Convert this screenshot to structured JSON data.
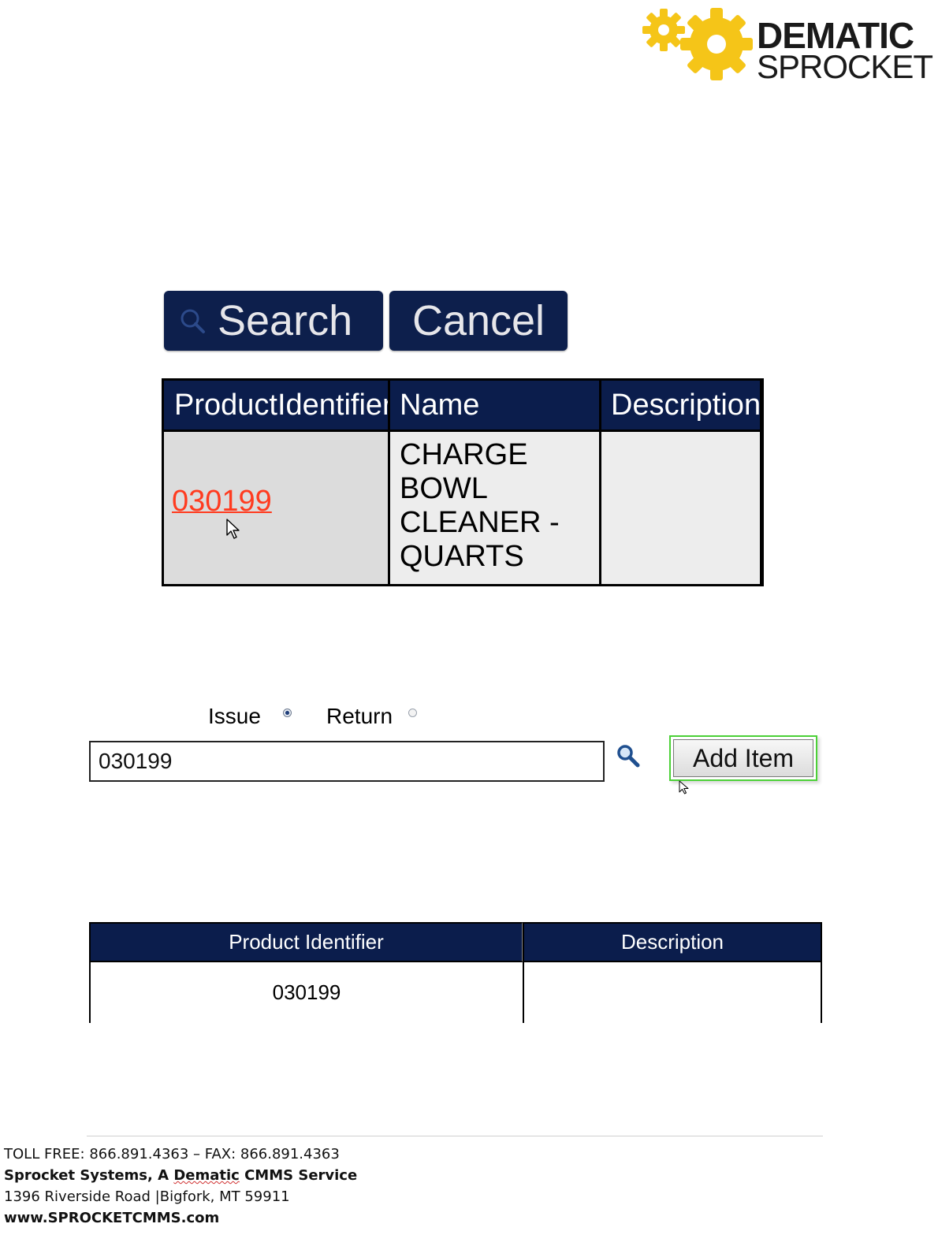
{
  "logo": {
    "line1": "DEMATIC",
    "line2": "SPROCKET",
    "gear_color": "#f5c518"
  },
  "search_buttons": {
    "search_label": "Search",
    "cancel_label": "Cancel",
    "color": "#0d1f4c"
  },
  "results_table": {
    "columns": [
      "ProductIdentifier",
      "Name",
      "Description"
    ],
    "rows": [
      {
        "product_identifier": "030199",
        "name_lines": [
          "CHARGE",
          "BOWL",
          "CLEANER -",
          "QUARTS"
        ],
        "description": ""
      }
    ]
  },
  "transaction_type": {
    "options": [
      {
        "label": "Issue",
        "selected": true
      },
      {
        "label": "Return",
        "selected": false
      }
    ]
  },
  "item_entry": {
    "value": "030199",
    "add_button_label": "Add Item"
  },
  "added_items_table": {
    "columns": [
      "Product Identifier",
      "Description"
    ],
    "rows": [
      {
        "product_identifier": "030199",
        "description": ""
      }
    ]
  },
  "footer": {
    "phone": "TOLL FREE: 866.891.4363 – FAX:  866.891.4363",
    "company_prefix": "Sprocket Systems, A ",
    "company_brand": "Dematic",
    "company_suffix": " CMMS Service",
    "address": "1396 Riverside  Road |Bigfork, MT 59911",
    "website": "www.SPROCKETCMMS.com"
  }
}
